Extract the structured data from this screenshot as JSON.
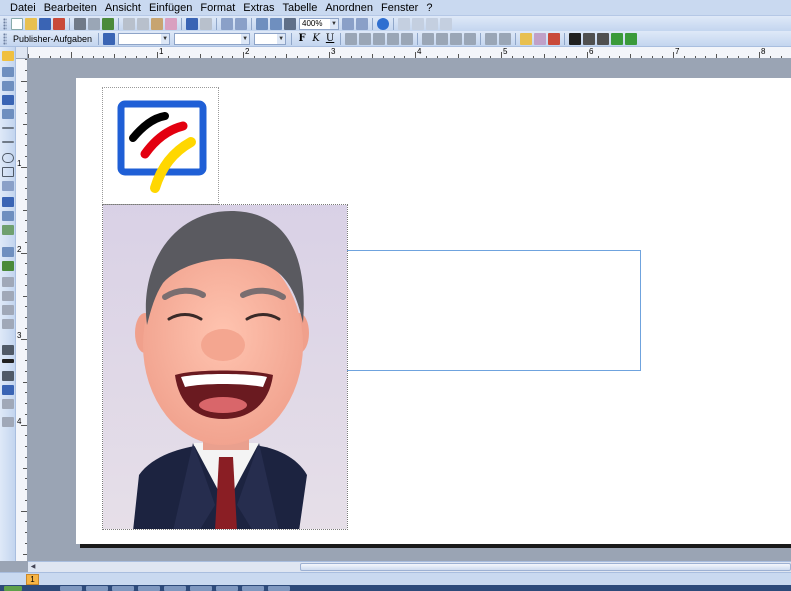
{
  "menu": [
    {
      "label": "Datei"
    },
    {
      "label": "Bearbeiten"
    },
    {
      "label": "Ansicht"
    },
    {
      "label": "Einfügen"
    },
    {
      "label": "Format"
    },
    {
      "label": "Extras"
    },
    {
      "label": "Tabelle"
    },
    {
      "label": "Anordnen"
    },
    {
      "label": "Fenster"
    },
    {
      "label": "?"
    }
  ],
  "toolbar1": {
    "zoom": "400%"
  },
  "toolbar2": {
    "task_pane_label": "Publisher-Aufgaben",
    "font_style": "",
    "font_name": "",
    "font_size": "",
    "bold": "F",
    "italic": "K",
    "underline": "U"
  },
  "hruler": {
    "labels": [
      "1",
      "2",
      "3",
      "4",
      "5",
      "6",
      "7",
      "8"
    ]
  },
  "vruler": {
    "labels": [
      "1",
      "2",
      "3",
      "4"
    ]
  },
  "status": {
    "current_page": "1"
  },
  "logo": {
    "stripe_colors": [
      "#000000",
      "#e3000f",
      "#ffd700"
    ],
    "border_color": "#1f5fd6"
  },
  "colors": {
    "text_frame_border": "#6fa3de",
    "accent": "#f7b546"
  }
}
